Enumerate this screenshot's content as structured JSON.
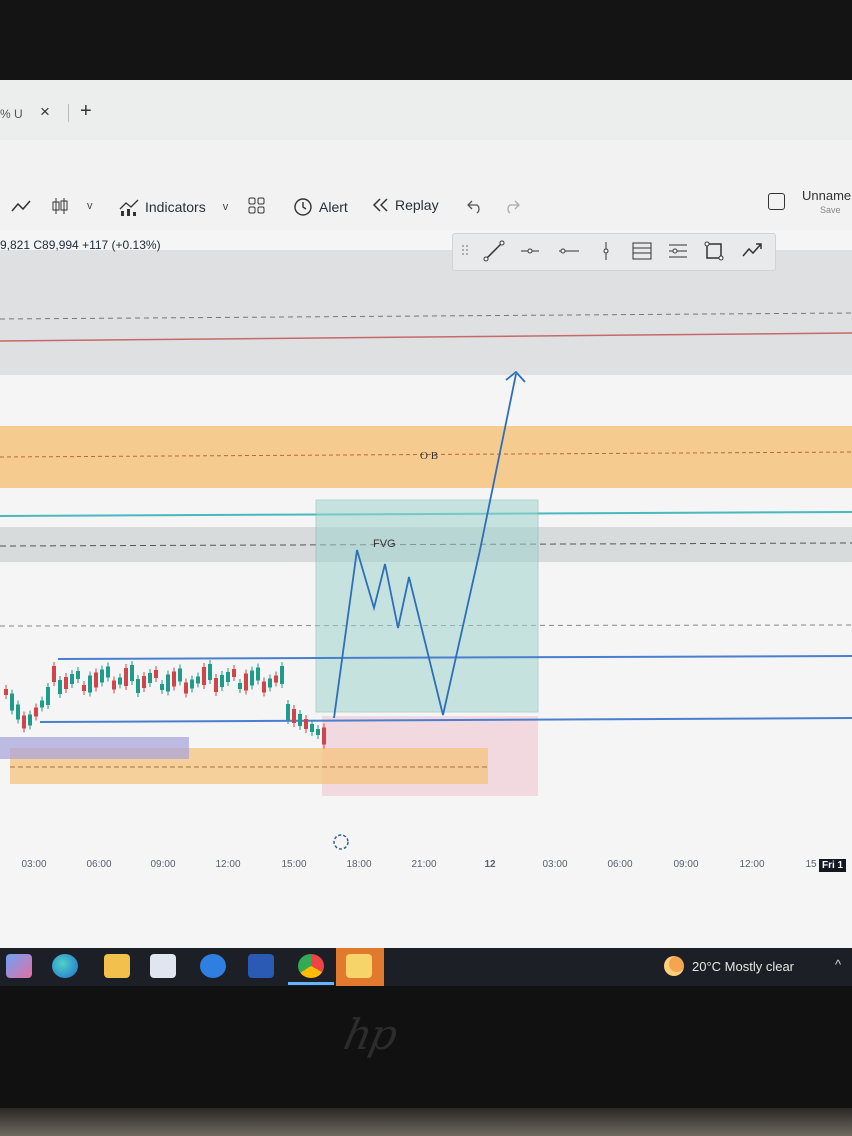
{
  "browser": {
    "tab_title": "% U",
    "close_glyph": "×",
    "new_tab_glyph": "+"
  },
  "toolbar": {
    "chart_type_icons": [
      "line-chart-icon",
      "candlestick-icon"
    ],
    "indicators_label": "Indicators",
    "alert_label": "Alert",
    "replay_label": "Replay",
    "layout_name": "Unname",
    "save_label": "Save"
  },
  "legend": {
    "ohlc_text": "9,821 C89,994 +117 (+0.13%)"
  },
  "drawing_toolbar": {
    "tools": [
      "drag-handle-icon",
      "trend-line-icon",
      "horizontal-ray-icon",
      "horizontal-line-icon",
      "vertical-line-icon",
      "parallel-channel-icon",
      "pitchfork-icon",
      "rectangle-icon",
      "path-icon"
    ]
  },
  "annotations": {
    "order_block_label": "O B",
    "fvg_label": "FVG"
  },
  "time_axis": {
    "ticks": [
      "03:00",
      "06:00",
      "09:00",
      "12:00",
      "15:00",
      "18:00",
      "21:00",
      "12",
      "03:00",
      "06:00",
      "09:00",
      "12:00",
      "15"
    ],
    "highlight_label": "Fri 1"
  },
  "colors": {
    "order_block_zone": "#f5c37e",
    "fvg_zone": "#9fd3cf",
    "projection_line": "#2e6fb8",
    "range_line": "#4a7fd0",
    "red_line": "#c7696b",
    "teal_line": "#48b9bf"
  },
  "taskbar": {
    "apps": [
      "widgets-icon",
      "edge-icon",
      "file-explorer-icon",
      "store-icon",
      "mail-icon",
      "word-icon",
      "chrome-icon",
      "files-icon"
    ],
    "weather_text": "20°C Mostly clear",
    "tray_glyph": "^"
  },
  "device": {
    "logo_text": "hp"
  }
}
